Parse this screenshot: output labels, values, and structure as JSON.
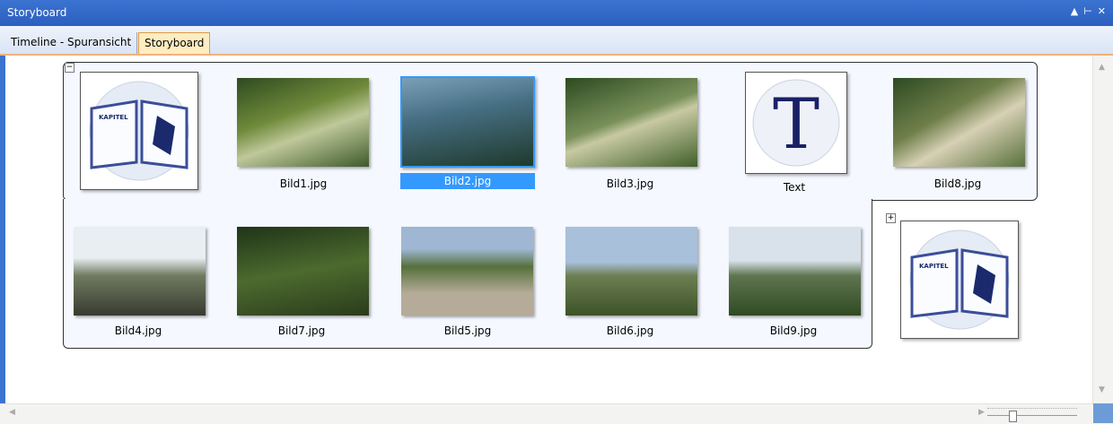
{
  "window": {
    "title": "Storyboard",
    "controls": [
      "▲",
      "⊢",
      "✕"
    ]
  },
  "tabs": [
    {
      "label": "Timeline - Spuransicht"
    },
    {
      "label": "Storyboard",
      "active": true
    }
  ],
  "row1": [
    {
      "type": "chapter",
      "caption": "",
      "book_text": "KAPITEL"
    },
    {
      "type": "photo",
      "caption": "Bild1.jpg"
    },
    {
      "type": "photo",
      "caption": "Bild2.jpg",
      "selected": true
    },
    {
      "type": "photo",
      "caption": "Bild3.jpg"
    },
    {
      "type": "text",
      "caption": "Text",
      "glyph": "T"
    },
    {
      "type": "photo",
      "caption": "Bild8.jpg"
    }
  ],
  "row2": [
    {
      "type": "photo",
      "caption": "Bild4.jpg"
    },
    {
      "type": "photo",
      "caption": "Bild7.jpg"
    },
    {
      "type": "photo",
      "caption": "Bild5.jpg"
    },
    {
      "type": "photo",
      "caption": "Bild6.jpg"
    },
    {
      "type": "photo",
      "caption": "Bild9.jpg"
    }
  ],
  "chapter2": {
    "book_text": "KAPITEL"
  },
  "colors": {
    "accent": "#3b73d1",
    "selected": "#3399ff",
    "tab_active": "#ffecc0"
  }
}
